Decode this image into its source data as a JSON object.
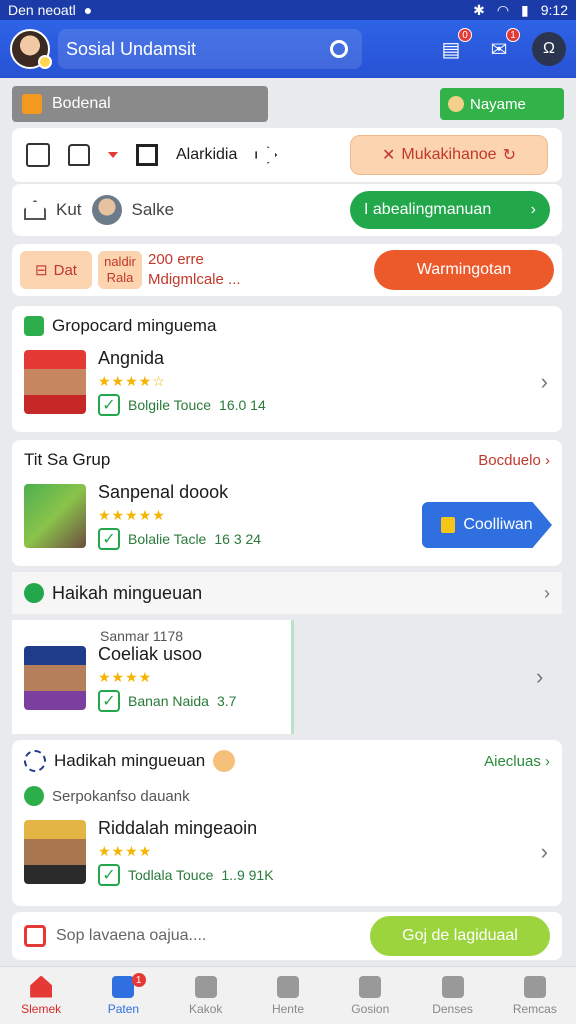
{
  "statusbar": {
    "carrier": "Den neoatl",
    "time": "9:12"
  },
  "appbar": {
    "title": "Sosial Undamsit",
    "badges": {
      "wallet": "0",
      "chat": "1"
    }
  },
  "section": {
    "label": "Bodenal",
    "name_chip": "Nayame"
  },
  "toolbar": {
    "brand": "Alarkidia",
    "peach_button": "Mukakihanoe"
  },
  "kit_row": {
    "kit": "Kut",
    "salke": "Salke",
    "green_button": "I abealingmanuan"
  },
  "promo": {
    "chip": "Dat",
    "small_top": "naldir",
    "small_bottom": "Rala",
    "line1": "200 erre",
    "line2": "Mdigmlcale ...",
    "button": "Warmingotan"
  },
  "group1": {
    "title": "Gropocard minguema",
    "item": {
      "name": "Angnida",
      "stars": "★★★★☆",
      "verified": "Bolgile Touce",
      "count": "16.0 14"
    }
  },
  "group2": {
    "title": "Tit Sa Grup",
    "link": "Bocduelo",
    "item": {
      "name": "Sanpenal doook",
      "stars": "★★★★★",
      "verified": "Bolalie Tacle",
      "count": "16 3 24"
    },
    "button": "Coolliwan"
  },
  "bar": {
    "title": "Haikah mingueuan"
  },
  "card3": {
    "sub": "Sanmar 1178",
    "name": "Coeliak usoo",
    "stars": "★★★★",
    "verified": "Banan Naida",
    "count": "3.7"
  },
  "group4": {
    "title": "Hadikah mingueuan",
    "link": "Aiecluas",
    "sub": "Serpokanfso dauank",
    "item": {
      "name": "Riddalah mingeaoin",
      "stars": "★★★★",
      "verified": "Todlala Touce",
      "count": "1..9 91K"
    }
  },
  "footer": {
    "placeholder": "Sop lavaena oajua....",
    "button": "Goj de lagiduaal"
  },
  "nav": [
    {
      "label": "Slemek",
      "badge": ""
    },
    {
      "label": "Paten",
      "badge": "1"
    },
    {
      "label": "Kakok",
      "badge": ""
    },
    {
      "label": "Hente",
      "badge": ""
    },
    {
      "label": "Gosion",
      "badge": ""
    },
    {
      "label": "Denses",
      "badge": ""
    },
    {
      "label": "Remcas",
      "badge": ""
    }
  ],
  "colors": {
    "primary": "#2f63e6",
    "green": "#22a74b",
    "orange": "#ec5a2c",
    "red": "#e53935"
  }
}
